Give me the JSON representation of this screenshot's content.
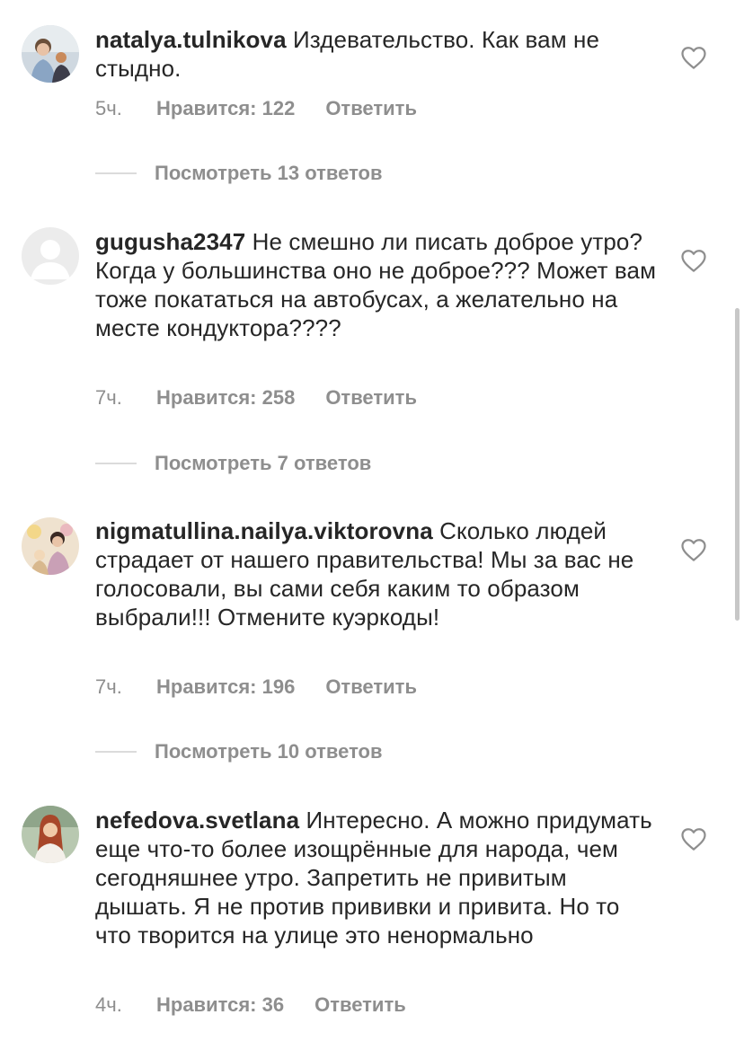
{
  "comments": [
    {
      "username": "natalya.tulnikova",
      "text": "Издевательство. Как вам не стыдно.",
      "time": "5ч.",
      "likes": "Нравится: 122",
      "reply": "Ответить",
      "view_replies": "Посмотреть 13 ответов",
      "avatar_icon": "user-photo"
    },
    {
      "username": "gugusha2347",
      "text": "Не смешно ли писать доброе утро? Когда у большинства оно не доброе??? Может вам тоже покататься на автобусах, а желательно на месте кондуктора????",
      "time": "7ч.",
      "likes": "Нравится: 258",
      "reply": "Ответить",
      "view_replies": "Посмотреть 7 ответов",
      "avatar_icon": "default-avatar"
    },
    {
      "username": "nigmatullina.nailya.viktorovna",
      "text": "Сколько людей страдает от нашего правительства! Мы за вас не голосовали, вы сами себя каким то образом выбрали!!! Отмените куэркоды!",
      "time": "7ч.",
      "likes": "Нравится: 196",
      "reply": "Ответить",
      "view_replies": "Посмотреть 10 ответов",
      "avatar_icon": "user-photo"
    },
    {
      "username": "nefedova.svetlana",
      "text": "Интересно. А можно придумать еще что-то более изощрённые для народа, чем сегодняшнее утро. Запретить не привитым дышать. Я не против прививки и  привита. Но то что творится на улице это ненормально",
      "time": "4ч.",
      "likes": "Нравится: 36",
      "reply": "Ответить",
      "avatar_icon": "user-photo"
    }
  ],
  "icons": {
    "like": "heart-outline-icon"
  },
  "colors": {
    "text": "#262626",
    "secondary": "#8e8e8e",
    "divider": "#dbdbdb",
    "background": "#ffffff"
  }
}
